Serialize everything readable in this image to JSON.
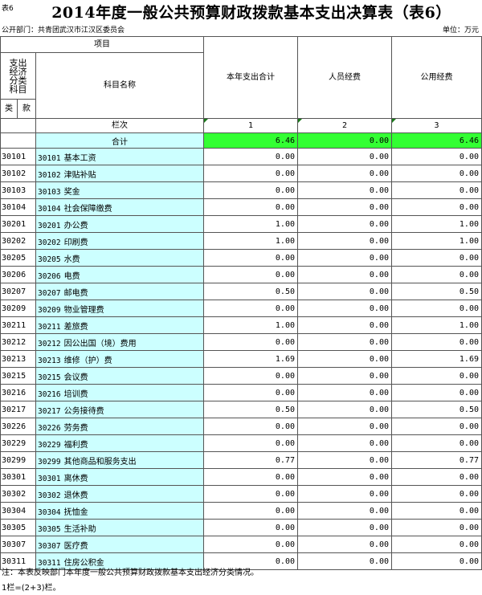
{
  "header": {
    "table_tag": "表6",
    "title": "2014年度一般公共预算财政拨款基本支出决算表（表6）",
    "department": "公开部门：共青团武汉市江汉区委员会",
    "unit": "单位：万元"
  },
  "columns": {
    "project": "项目",
    "econ_class": "支出经济分类科目",
    "subject_name": "科目名称",
    "lei": "类",
    "kuan": "款",
    "row_label": "栏次",
    "total_label": "合计",
    "total_spending": "本年支出合计",
    "personnel": "人员经费",
    "public": "公用经费",
    "num1": "1",
    "num2": "2",
    "num3": "3"
  },
  "totals": {
    "total": "6.46",
    "personnel": "0.00",
    "public": "6.46"
  },
  "rows": [
    {
      "code": "30101",
      "name_code": "30101",
      "name": "基本工资",
      "total": "0.00",
      "personnel": "0.00",
      "public": "0.00"
    },
    {
      "code": "30102",
      "name_code": "30102",
      "name": "津贴补贴",
      "total": "0.00",
      "personnel": "0.00",
      "public": "0.00"
    },
    {
      "code": "30103",
      "name_code": "30103",
      "name": "奖金",
      "total": "0.00",
      "personnel": "0.00",
      "public": "0.00"
    },
    {
      "code": "30104",
      "name_code": "30104",
      "name": "社会保障缴费",
      "total": "0.00",
      "personnel": "0.00",
      "public": "0.00"
    },
    {
      "code": "30201",
      "name_code": "30201",
      "name": "办公费",
      "total": "1.00",
      "personnel": "0.00",
      "public": "1.00"
    },
    {
      "code": "30202",
      "name_code": "30202",
      "name": "印刷费",
      "total": "1.00",
      "personnel": "0.00",
      "public": "1.00"
    },
    {
      "code": "30205",
      "name_code": "30205",
      "name": "水费",
      "total": "0.00",
      "personnel": "0.00",
      "public": "0.00"
    },
    {
      "code": "30206",
      "name_code": "30206",
      "name": "电费",
      "total": "0.00",
      "personnel": "0.00",
      "public": "0.00"
    },
    {
      "code": "30207",
      "name_code": "30207",
      "name": "邮电费",
      "total": "0.50",
      "personnel": "0.00",
      "public": "0.50"
    },
    {
      "code": "30209",
      "name_code": "30209",
      "name": "物业管理费",
      "total": "0.00",
      "personnel": "0.00",
      "public": "0.00"
    },
    {
      "code": "30211",
      "name_code": "30211",
      "name": "差旅费",
      "total": "1.00",
      "personnel": "0.00",
      "public": "1.00"
    },
    {
      "code": "30212",
      "name_code": "30212",
      "name": "因公出国（境）费用",
      "total": "0.00",
      "personnel": "0.00",
      "public": "0.00"
    },
    {
      "code": "30213",
      "name_code": "30213",
      "name": "维修（护）费",
      "total": "1.69",
      "personnel": "0.00",
      "public": "1.69"
    },
    {
      "code": "30215",
      "name_code": "30215",
      "name": "会议费",
      "total": "0.00",
      "personnel": "0.00",
      "public": "0.00"
    },
    {
      "code": "30216",
      "name_code": "30216",
      "name": "培训费",
      "total": "0.00",
      "personnel": "0.00",
      "public": "0.00"
    },
    {
      "code": "30217",
      "name_code": "30217",
      "name": "公务接待费",
      "total": "0.50",
      "personnel": "0.00",
      "public": "0.50"
    },
    {
      "code": "30226",
      "name_code": "30226",
      "name": "劳务费",
      "total": "0.00",
      "personnel": "0.00",
      "public": "0.00"
    },
    {
      "code": "30229",
      "name_code": "30229",
      "name": "福利费",
      "total": "0.00",
      "personnel": "0.00",
      "public": "0.00"
    },
    {
      "code": "30299",
      "name_code": "30299",
      "name": "其他商品和服务支出",
      "total": "0.77",
      "personnel": "0.00",
      "public": "0.77"
    },
    {
      "code": "30301",
      "name_code": "30301",
      "name": "离休费",
      "total": "0.00",
      "personnel": "0.00",
      "public": "0.00"
    },
    {
      "code": "30302",
      "name_code": "30302",
      "name": "退休费",
      "total": "0.00",
      "personnel": "0.00",
      "public": "0.00"
    },
    {
      "code": "30304",
      "name_code": "30304",
      "name": "抚恤金",
      "total": "0.00",
      "personnel": "0.00",
      "public": "0.00"
    },
    {
      "code": "30305",
      "name_code": "30305",
      "name": "生活补助",
      "total": "0.00",
      "personnel": "0.00",
      "public": "0.00"
    },
    {
      "code": "30307",
      "name_code": "30307",
      "name": "医疗费",
      "total": "0.00",
      "personnel": "0.00",
      "public": "0.00"
    },
    {
      "code": "30311",
      "name_code": "30311",
      "name": "住房公积金",
      "total": "0.00",
      "personnel": "0.00",
      "public": "0.00"
    }
  ],
  "notes": {
    "line1": "注：本表反映部门本年度一般公共预算财政拨款基本支出经济分类情况。",
    "line2": "1栏=(2+3)栏。"
  }
}
